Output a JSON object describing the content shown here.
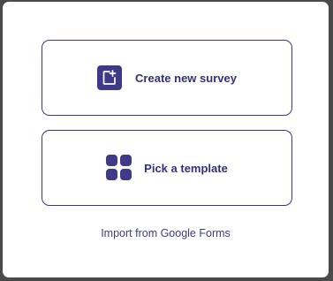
{
  "dialog": {
    "options": [
      {
        "label": "Create new survey",
        "icon": "add-document-icon"
      },
      {
        "label": "Pick a template",
        "icon": "grid-icon"
      }
    ],
    "import_link": "Import from Google Forms"
  },
  "colors": {
    "accent": "#3e3a88",
    "text": "#332f7a",
    "border": "#3a3580",
    "backdrop": "#4a4a4a"
  }
}
